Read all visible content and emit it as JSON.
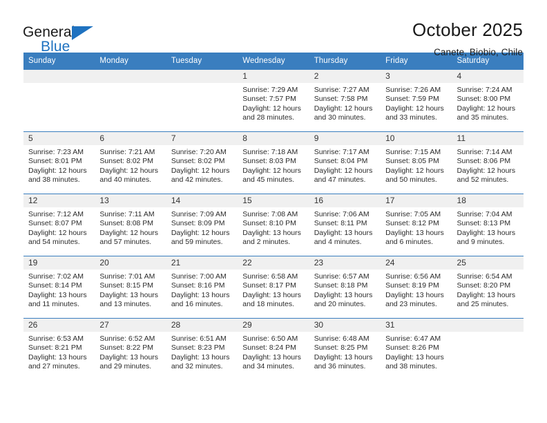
{
  "brand": {
    "name_part1": "General",
    "name_part2": "Blue",
    "logo_icon": "blue-triangle-flag"
  },
  "header": {
    "title": "October 2025",
    "location": "Canete, Biobio, Chile"
  },
  "colors": {
    "header_blue": "#3a7ebf",
    "brand_blue": "#1f72c0",
    "daynum_band": "#f0f0f0",
    "text": "#2b2b2b"
  },
  "weekdays": [
    "Sunday",
    "Monday",
    "Tuesday",
    "Wednesday",
    "Thursday",
    "Friday",
    "Saturday"
  ],
  "labels": {
    "sunrise": "Sunrise:",
    "sunset": "Sunset:",
    "daylight": "Daylight:"
  },
  "weeks": [
    [
      {
        "day": "",
        "sunrise": "",
        "sunset": "",
        "daylight_line1": "",
        "daylight_line2": ""
      },
      {
        "day": "",
        "sunrise": "",
        "sunset": "",
        "daylight_line1": "",
        "daylight_line2": ""
      },
      {
        "day": "",
        "sunrise": "",
        "sunset": "",
        "daylight_line1": "",
        "daylight_line2": ""
      },
      {
        "day": "1",
        "sunrise": "Sunrise: 7:29 AM",
        "sunset": "Sunset: 7:57 PM",
        "daylight_line1": "Daylight: 12 hours",
        "daylight_line2": "and 28 minutes."
      },
      {
        "day": "2",
        "sunrise": "Sunrise: 7:27 AM",
        "sunset": "Sunset: 7:58 PM",
        "daylight_line1": "Daylight: 12 hours",
        "daylight_line2": "and 30 minutes."
      },
      {
        "day": "3",
        "sunrise": "Sunrise: 7:26 AM",
        "sunset": "Sunset: 7:59 PM",
        "daylight_line1": "Daylight: 12 hours",
        "daylight_line2": "and 33 minutes."
      },
      {
        "day": "4",
        "sunrise": "Sunrise: 7:24 AM",
        "sunset": "Sunset: 8:00 PM",
        "daylight_line1": "Daylight: 12 hours",
        "daylight_line2": "and 35 minutes."
      }
    ],
    [
      {
        "day": "5",
        "sunrise": "Sunrise: 7:23 AM",
        "sunset": "Sunset: 8:01 PM",
        "daylight_line1": "Daylight: 12 hours",
        "daylight_line2": "and 38 minutes."
      },
      {
        "day": "6",
        "sunrise": "Sunrise: 7:21 AM",
        "sunset": "Sunset: 8:02 PM",
        "daylight_line1": "Daylight: 12 hours",
        "daylight_line2": "and 40 minutes."
      },
      {
        "day": "7",
        "sunrise": "Sunrise: 7:20 AM",
        "sunset": "Sunset: 8:02 PM",
        "daylight_line1": "Daylight: 12 hours",
        "daylight_line2": "and 42 minutes."
      },
      {
        "day": "8",
        "sunrise": "Sunrise: 7:18 AM",
        "sunset": "Sunset: 8:03 PM",
        "daylight_line1": "Daylight: 12 hours",
        "daylight_line2": "and 45 minutes."
      },
      {
        "day": "9",
        "sunrise": "Sunrise: 7:17 AM",
        "sunset": "Sunset: 8:04 PM",
        "daylight_line1": "Daylight: 12 hours",
        "daylight_line2": "and 47 minutes."
      },
      {
        "day": "10",
        "sunrise": "Sunrise: 7:15 AM",
        "sunset": "Sunset: 8:05 PM",
        "daylight_line1": "Daylight: 12 hours",
        "daylight_line2": "and 50 minutes."
      },
      {
        "day": "11",
        "sunrise": "Sunrise: 7:14 AM",
        "sunset": "Sunset: 8:06 PM",
        "daylight_line1": "Daylight: 12 hours",
        "daylight_line2": "and 52 minutes."
      }
    ],
    [
      {
        "day": "12",
        "sunrise": "Sunrise: 7:12 AM",
        "sunset": "Sunset: 8:07 PM",
        "daylight_line1": "Daylight: 12 hours",
        "daylight_line2": "and 54 minutes."
      },
      {
        "day": "13",
        "sunrise": "Sunrise: 7:11 AM",
        "sunset": "Sunset: 8:08 PM",
        "daylight_line1": "Daylight: 12 hours",
        "daylight_line2": "and 57 minutes."
      },
      {
        "day": "14",
        "sunrise": "Sunrise: 7:09 AM",
        "sunset": "Sunset: 8:09 PM",
        "daylight_line1": "Daylight: 12 hours",
        "daylight_line2": "and 59 minutes."
      },
      {
        "day": "15",
        "sunrise": "Sunrise: 7:08 AM",
        "sunset": "Sunset: 8:10 PM",
        "daylight_line1": "Daylight: 13 hours",
        "daylight_line2": "and 2 minutes."
      },
      {
        "day": "16",
        "sunrise": "Sunrise: 7:06 AM",
        "sunset": "Sunset: 8:11 PM",
        "daylight_line1": "Daylight: 13 hours",
        "daylight_line2": "and 4 minutes."
      },
      {
        "day": "17",
        "sunrise": "Sunrise: 7:05 AM",
        "sunset": "Sunset: 8:12 PM",
        "daylight_line1": "Daylight: 13 hours",
        "daylight_line2": "and 6 minutes."
      },
      {
        "day": "18",
        "sunrise": "Sunrise: 7:04 AM",
        "sunset": "Sunset: 8:13 PM",
        "daylight_line1": "Daylight: 13 hours",
        "daylight_line2": "and 9 minutes."
      }
    ],
    [
      {
        "day": "19",
        "sunrise": "Sunrise: 7:02 AM",
        "sunset": "Sunset: 8:14 PM",
        "daylight_line1": "Daylight: 13 hours",
        "daylight_line2": "and 11 minutes."
      },
      {
        "day": "20",
        "sunrise": "Sunrise: 7:01 AM",
        "sunset": "Sunset: 8:15 PM",
        "daylight_line1": "Daylight: 13 hours",
        "daylight_line2": "and 13 minutes."
      },
      {
        "day": "21",
        "sunrise": "Sunrise: 7:00 AM",
        "sunset": "Sunset: 8:16 PM",
        "daylight_line1": "Daylight: 13 hours",
        "daylight_line2": "and 16 minutes."
      },
      {
        "day": "22",
        "sunrise": "Sunrise: 6:58 AM",
        "sunset": "Sunset: 8:17 PM",
        "daylight_line1": "Daylight: 13 hours",
        "daylight_line2": "and 18 minutes."
      },
      {
        "day": "23",
        "sunrise": "Sunrise: 6:57 AM",
        "sunset": "Sunset: 8:18 PM",
        "daylight_line1": "Daylight: 13 hours",
        "daylight_line2": "and 20 minutes."
      },
      {
        "day": "24",
        "sunrise": "Sunrise: 6:56 AM",
        "sunset": "Sunset: 8:19 PM",
        "daylight_line1": "Daylight: 13 hours",
        "daylight_line2": "and 23 minutes."
      },
      {
        "day": "25",
        "sunrise": "Sunrise: 6:54 AM",
        "sunset": "Sunset: 8:20 PM",
        "daylight_line1": "Daylight: 13 hours",
        "daylight_line2": "and 25 minutes."
      }
    ],
    [
      {
        "day": "26",
        "sunrise": "Sunrise: 6:53 AM",
        "sunset": "Sunset: 8:21 PM",
        "daylight_line1": "Daylight: 13 hours",
        "daylight_line2": "and 27 minutes."
      },
      {
        "day": "27",
        "sunrise": "Sunrise: 6:52 AM",
        "sunset": "Sunset: 8:22 PM",
        "daylight_line1": "Daylight: 13 hours",
        "daylight_line2": "and 29 minutes."
      },
      {
        "day": "28",
        "sunrise": "Sunrise: 6:51 AM",
        "sunset": "Sunset: 8:23 PM",
        "daylight_line1": "Daylight: 13 hours",
        "daylight_line2": "and 32 minutes."
      },
      {
        "day": "29",
        "sunrise": "Sunrise: 6:50 AM",
        "sunset": "Sunset: 8:24 PM",
        "daylight_line1": "Daylight: 13 hours",
        "daylight_line2": "and 34 minutes."
      },
      {
        "day": "30",
        "sunrise": "Sunrise: 6:48 AM",
        "sunset": "Sunset: 8:25 PM",
        "daylight_line1": "Daylight: 13 hours",
        "daylight_line2": "and 36 minutes."
      },
      {
        "day": "31",
        "sunrise": "Sunrise: 6:47 AM",
        "sunset": "Sunset: 8:26 PM",
        "daylight_line1": "Daylight: 13 hours",
        "daylight_line2": "and 38 minutes."
      },
      {
        "day": "",
        "sunrise": "",
        "sunset": "",
        "daylight_line1": "",
        "daylight_line2": ""
      }
    ]
  ]
}
